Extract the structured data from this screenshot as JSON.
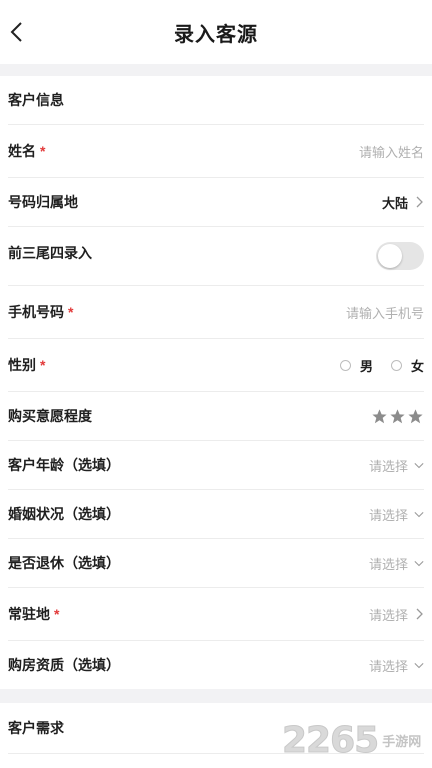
{
  "header": {
    "title": "录入客源"
  },
  "sections": {
    "customer_info": "客户信息",
    "customer_needs": "客户需求"
  },
  "fields": {
    "name": {
      "label": "姓名",
      "required_mark": "*",
      "placeholder": "请输入姓名"
    },
    "phone_region": {
      "label": "号码归属地",
      "value": "大陆"
    },
    "partial_entry": {
      "label": "前三尾四录入",
      "toggle_on": false
    },
    "phone": {
      "label": "手机号码",
      "required_mark": "*",
      "placeholder": "请输入手机号"
    },
    "gender": {
      "label": "性别",
      "required_mark": "*",
      "options": [
        "男",
        "女"
      ],
      "selected": null
    },
    "purchase_intent": {
      "label": "购买意愿程度",
      "stars": 3
    },
    "age": {
      "label": "客户年龄（选填）",
      "placeholder": "请选择"
    },
    "marital": {
      "label": "婚姻状况（选填）",
      "placeholder": "请选择"
    },
    "retired": {
      "label": "是否退休（选填）",
      "placeholder": "请选择"
    },
    "residence": {
      "label": "常驻地",
      "required_mark": "*",
      "placeholder": "请选择"
    },
    "qualification": {
      "label": "购房资质（选填）",
      "placeholder": "请选择"
    }
  },
  "watermark": {
    "number": "2265",
    "text": "手游网"
  },
  "colors": {
    "required": "#e23a3a",
    "background_gap": "#f2f2f4",
    "star": "#8c8c8c"
  }
}
